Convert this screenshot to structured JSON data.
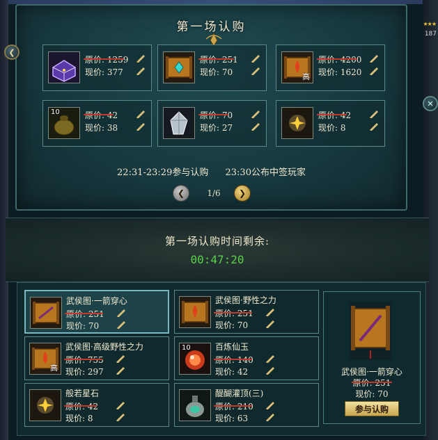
{
  "header": {
    "right_count": "187"
  },
  "top_panel": {
    "title": "第一场认购",
    "items": [
      {
        "name": "purple-chest",
        "original_label": "原价: 1259",
        "current_label": "现价: 377",
        "qty": "",
        "tag": ""
      },
      {
        "name": "scroll-cyan",
        "original_label": "原价: 251",
        "current_label": "现价: 70",
        "qty": "",
        "tag": ""
      },
      {
        "name": "scroll-red-high",
        "original_label": "原价: 4200",
        "current_label": "现价: 1620",
        "qty": "",
        "tag": "高"
      },
      {
        "name": "gourd-pouch",
        "original_label": "原价: 42",
        "current_label": "现价: 38",
        "qty": "10",
        "tag": ""
      },
      {
        "name": "silver-crystal",
        "original_label": "原价: 70",
        "current_label": "现价: 27",
        "qty": "",
        "tag": ""
      },
      {
        "name": "star-stone",
        "original_label": "原价: 42",
        "current_label": "现价: 8",
        "qty": "",
        "tag": ""
      }
    ],
    "schedule": {
      "join_time": "22:31-23:29参与认购",
      "announce": "23:30公布中签玩家"
    },
    "pager": {
      "page": "1/6"
    }
  },
  "countdown": {
    "title": "第一场认购时间剩余:",
    "time": "00:47:20"
  },
  "bottom_list": [
    {
      "name": "武侯图·一箭穿心",
      "original_label": "原价: 251",
      "current_label": "现价: 70",
      "qty": "",
      "tag": "",
      "selected": true
    },
    {
      "name": "武侯图·野性之力",
      "original_label": "原价: 251",
      "current_label": "现价: 70",
      "qty": "",
      "tag": "",
      "selected": false
    },
    {
      "name": "武侯图·高级野性之力",
      "original_label": "原价: 755",
      "current_label": "现价: 297",
      "qty": "",
      "tag": "高",
      "selected": false
    },
    {
      "name": "百炼仙玉",
      "original_label": "原价: 140",
      "current_label": "现价: 42",
      "qty": "10",
      "tag": "",
      "selected": false
    },
    {
      "name": "般若星石",
      "original_label": "原价: 42",
      "current_label": "现价: 8",
      "qty": "",
      "tag": "",
      "selected": false
    },
    {
      "name": "醍醐灌顶(三)",
      "original_label": "原价: 210",
      "current_label": "现价: 63",
      "qty": "",
      "tag": "",
      "selected": false
    }
  ],
  "detail": {
    "name": "武侯图·一箭穿心",
    "original_label": "原价: 251",
    "current_label": "现价: 70",
    "join_button": "参与认购"
  },
  "colors": {
    "strike": "#c0392b",
    "countdown": "#57d24a",
    "panel_border": "#5b8a8a",
    "button_gold": "#c9a64e"
  }
}
